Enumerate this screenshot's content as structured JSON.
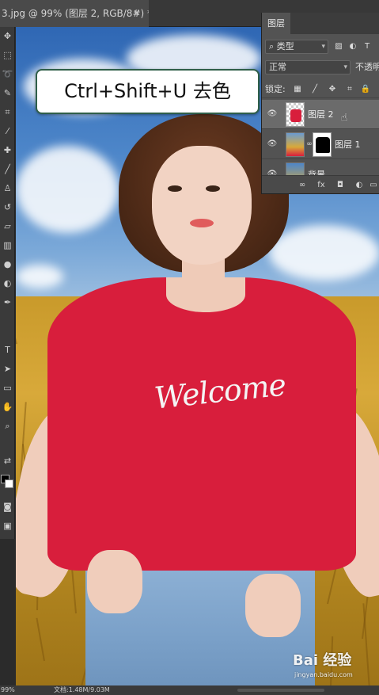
{
  "document": {
    "tab_title": "3.jpg @ 99% (图层 2, RGB/8#) *",
    "close_glyph": "✕"
  },
  "callout": {
    "text": "Ctrl+Shift+U 去色",
    "border_color": "#2f5f49"
  },
  "layers_panel": {
    "tab_label": "图层",
    "filter_type": "类型",
    "blend_mode": "正常",
    "opacity_label": "不透明",
    "lock_label": "锁定:",
    "layers": [
      {
        "name": "图层 2",
        "selected": true,
        "visible": true,
        "thumbnail": "shirt-layer",
        "has_mask": false
      },
      {
        "name": "图层 1",
        "selected": false,
        "visible": true,
        "thumbnail": "photo-layer",
        "has_mask": true
      },
      {
        "name": "背景",
        "selected": false,
        "visible": true,
        "thumbnail": "background-layer",
        "has_mask": false
      }
    ],
    "bottom_fx_label": "fx"
  },
  "photo": {
    "shirt_text": "Welcome",
    "shirt_color": "#d81e3c"
  },
  "statusbar": {
    "zoom": "99%",
    "doc_info": "文档:1.48M/9.03M"
  },
  "watermark": {
    "brand": "Bai 经验",
    "url": "jingyan.baidu.com"
  },
  "icons": {
    "toolbar": [
      "move-icon",
      "marquee-icon",
      "lasso-icon",
      "quick-select-icon",
      "crop-icon",
      "eyedropper-icon",
      "healing-brush-icon",
      "brush-icon",
      "clone-stamp-icon",
      "history-brush-icon",
      "eraser-icon",
      "gradient-icon",
      "blur-icon",
      "dodge-icon",
      "pen-icon",
      "type-icon",
      "path-select-icon",
      "rectangle-icon",
      "hand-icon",
      "zoom-icon"
    ]
  }
}
